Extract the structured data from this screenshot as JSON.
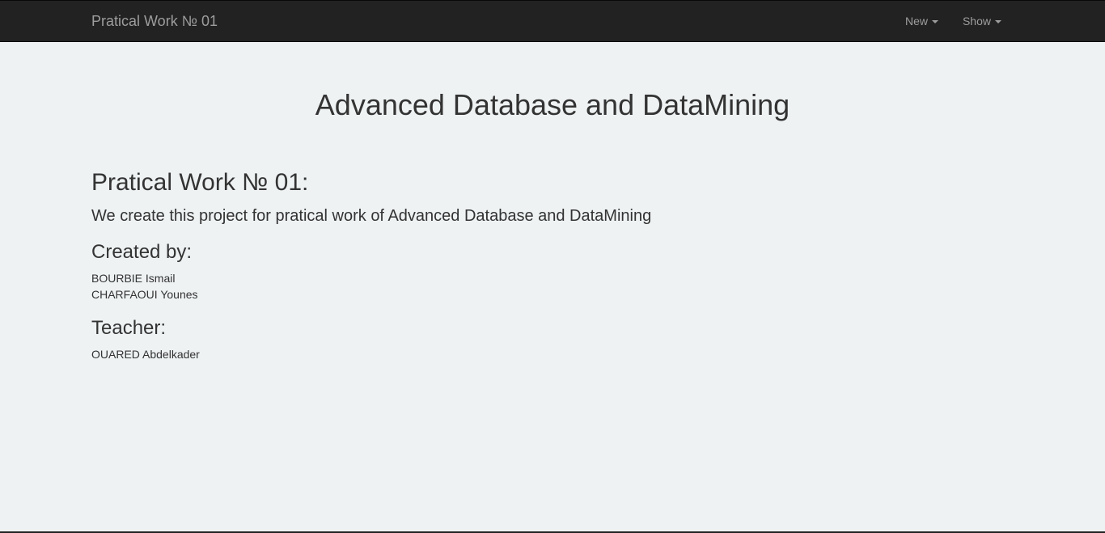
{
  "navbar": {
    "brand": "Pratical Work № 01",
    "menu": [
      {
        "label": "New"
      },
      {
        "label": "Show"
      }
    ]
  },
  "main": {
    "title": "Advanced Database and DataMining",
    "section_title": "Pratical Work № 01:",
    "description": "We create this project for pratical work of Advanced Database and DataMining",
    "created_by_heading": "Created by:",
    "authors": [
      "BOURBIE Ismail",
      "CHARFAOUI Younes"
    ],
    "teacher_heading": "Teacher:",
    "teacher": "OUARED Abdelkader"
  },
  "colors": {
    "navbar_bg": "#222222",
    "navbar_text": "#9d9d9d",
    "page_bg": "#eef2f3",
    "text": "#333333"
  },
  "icons": {
    "dropdown": "caret-down-icon"
  }
}
